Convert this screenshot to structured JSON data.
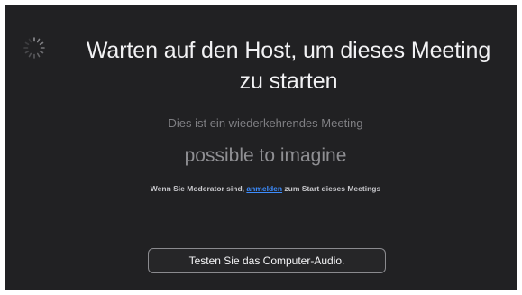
{
  "window": {
    "background_color": "#212123"
  },
  "waiting_screen": {
    "spinner_icon": "loading-spinner-icon",
    "title_line_1": "Warten auf den Host, um dieses Meeting",
    "title_line_2": "zu starten",
    "subtitle": "Dies ist ein wiederkehrendes Meeting",
    "meeting_name": "possible to imagine",
    "host_note_before": "Wenn Sie Moderator sind, ",
    "host_note_link": "anmelden",
    "host_note_after": " zum Start dieses Meetings",
    "link_color": "#3d8dff",
    "test_audio_button": "Testen Sie das Computer-Audio."
  }
}
